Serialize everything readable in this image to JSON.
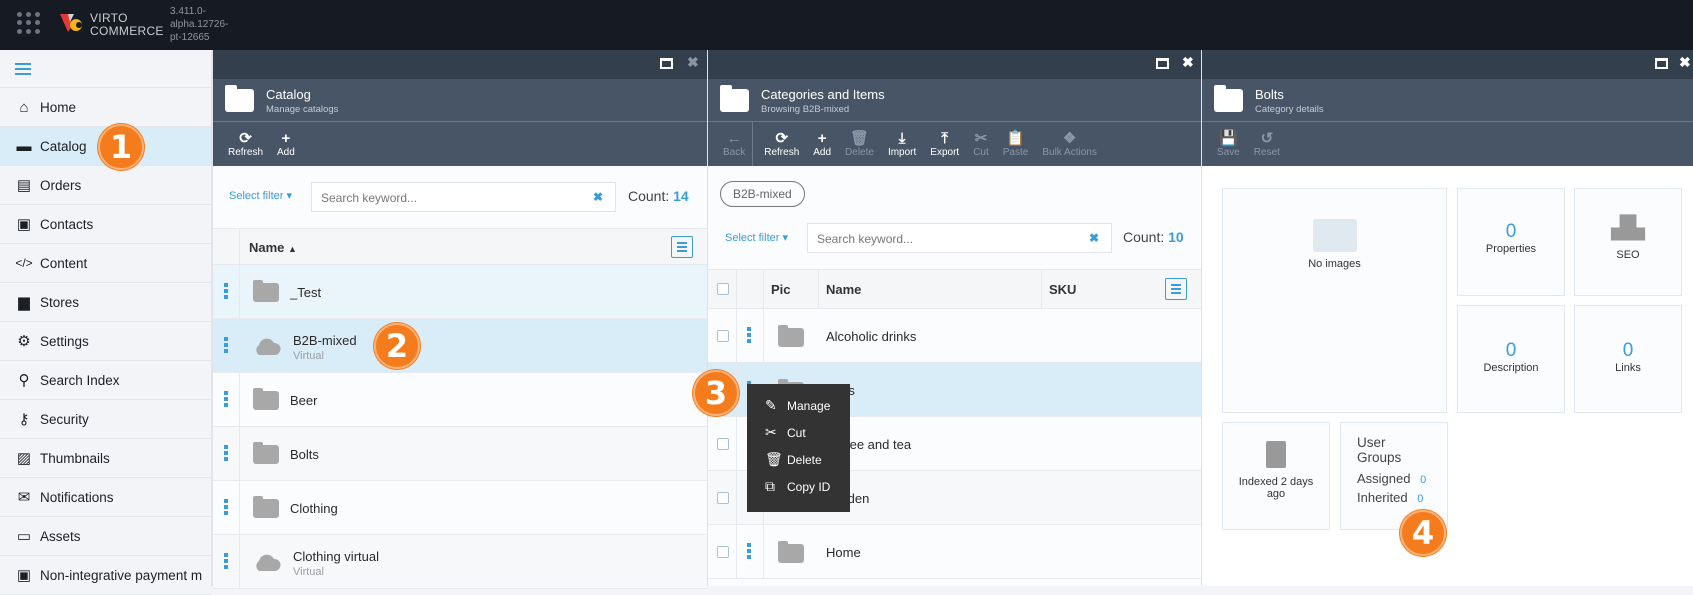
{
  "app": {
    "brand_line1": "VIRTO",
    "brand_line2": "COMMERCE",
    "version": "3.411.0-alpha.12726-pt-12665",
    "accent": "#3a9dd8",
    "badge_color": "#f47c1d"
  },
  "sidebar": {
    "items": [
      {
        "label": "Home",
        "icon": "home-icon"
      },
      {
        "label": "Catalog",
        "icon": "folder-icon",
        "active": true
      },
      {
        "label": "Orders",
        "icon": "file-icon"
      },
      {
        "label": "Contacts",
        "icon": "id-card-icon"
      },
      {
        "label": "Content",
        "icon": "code-icon"
      },
      {
        "label": "Stores",
        "icon": "archive-icon"
      },
      {
        "label": "Settings",
        "icon": "gears-icon"
      },
      {
        "label": "Search Index",
        "icon": "search-icon"
      },
      {
        "label": "Security",
        "icon": "key-icon"
      },
      {
        "label": "Thumbnails",
        "icon": "image-icon"
      },
      {
        "label": "Notifications",
        "icon": "envelope-icon"
      },
      {
        "label": "Assets",
        "icon": "folder-outline-icon"
      },
      {
        "label": "Non-integrative payment m",
        "icon": "money-icon"
      }
    ]
  },
  "blade1": {
    "title": "Catalog",
    "subtitle": "Manage catalogs",
    "toolbar": [
      "Refresh",
      "Add"
    ],
    "filter_label": "Select filter",
    "search_placeholder": "Search keyword...",
    "count_label": "Count:",
    "count": "14",
    "column": "Name",
    "rows": [
      {
        "name": "_Test",
        "type": "folder"
      },
      {
        "name": "B2B-mixed",
        "sub": "Virtual",
        "type": "cloud"
      },
      {
        "name": "Beer",
        "type": "folder"
      },
      {
        "name": "Bolts",
        "type": "folder"
      },
      {
        "name": "Clothing",
        "type": "folder"
      },
      {
        "name": "Clothing virtual",
        "sub": "Virtual",
        "type": "cloud"
      }
    ]
  },
  "blade2": {
    "title": "Categories and Items",
    "subtitle": "Browsing B2B-mixed",
    "toolbar": [
      {
        "label": "Back",
        "disabled": true
      },
      {
        "label": "Refresh"
      },
      {
        "label": "Add"
      },
      {
        "label": "Delete",
        "disabled": true
      },
      {
        "label": "Import"
      },
      {
        "label": "Export"
      },
      {
        "label": "Cut",
        "disabled": true
      },
      {
        "label": "Paste",
        "disabled": true
      },
      {
        "label": "Bulk Actions",
        "disabled": true
      }
    ],
    "breadcrumb": "B2B-mixed",
    "filter_label": "Select filter",
    "search_placeholder": "Search keyword...",
    "count_label": "Count:",
    "count": "10",
    "columns": [
      "Pic",
      "Name",
      "SKU"
    ],
    "rows": [
      "Alcoholic drinks",
      "Bolts",
      "Coffee and tea",
      "Garden",
      "Home"
    ],
    "context_menu": [
      "Manage",
      "Cut",
      "Delete",
      "Copy ID"
    ]
  },
  "blade3": {
    "title": "Bolts",
    "subtitle": "Category details",
    "toolbar": [
      "Save",
      "Reset"
    ],
    "no_images": "No images",
    "tiles": {
      "properties": {
        "value": "0",
        "label": "Properties"
      },
      "seo": {
        "label": "SEO"
      },
      "description": {
        "value": "0",
        "label": "Description"
      },
      "links": {
        "value": "0",
        "label": "Links"
      },
      "indexed": "Indexed 2 days ago"
    },
    "user_groups": {
      "title": "User Groups",
      "assigned_label": "Assigned",
      "assigned": "0",
      "inherited_label": "Inherited",
      "inherited": "0"
    }
  },
  "badges": [
    "1",
    "2",
    "3",
    "4"
  ]
}
